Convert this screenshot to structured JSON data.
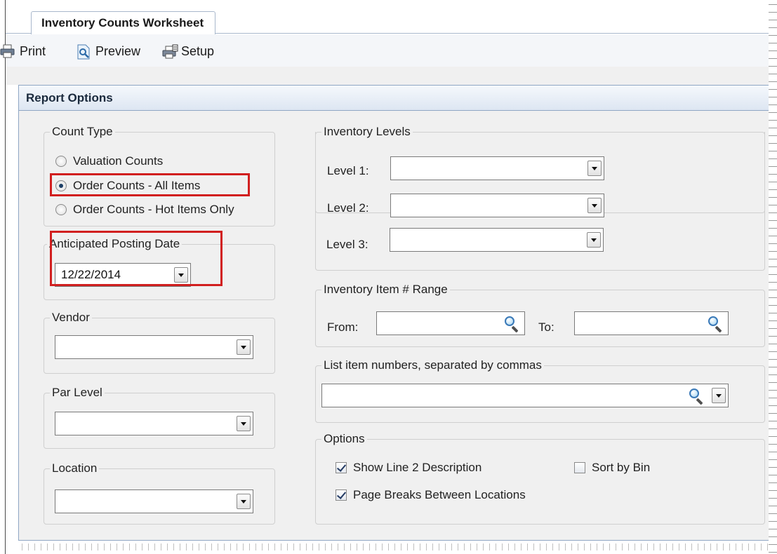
{
  "window": {
    "tab_label": "Inventory Counts Worksheet"
  },
  "toolbar": {
    "buttons": [
      {
        "label": "Print",
        "icon": "printer-icon"
      },
      {
        "label": "Preview",
        "icon": "preview-icon"
      },
      {
        "label": "Setup",
        "icon": "setup-icon"
      }
    ]
  },
  "panel": {
    "title": "Report Options"
  },
  "count_type": {
    "title": "Count Type",
    "options": [
      {
        "label": "Valuation Counts",
        "selected": false
      },
      {
        "label": "Order Counts - All Items",
        "selected": true
      },
      {
        "label": "Order Counts - Hot Items Only",
        "selected": false
      }
    ]
  },
  "posting_date": {
    "title": "Anticipated Posting Date",
    "value": "12/22/2014"
  },
  "vendor": {
    "title": "Vendor",
    "value": ""
  },
  "par_level": {
    "title": "Par Level",
    "value": ""
  },
  "location": {
    "title": "Location",
    "value": ""
  },
  "inventory_levels": {
    "title": "Inventory Levels",
    "levels": [
      {
        "label": "Level 1:",
        "value": ""
      },
      {
        "label": "Level 2:",
        "value": ""
      },
      {
        "label": "Level 3:",
        "value": ""
      }
    ]
  },
  "item_range": {
    "title": "Inventory Item # Range",
    "from_label": "From:",
    "to_label": "To:",
    "from_value": "",
    "to_value": ""
  },
  "item_list": {
    "title": "List item numbers, separated by commas",
    "value": ""
  },
  "options": {
    "title": "Options",
    "checkboxes": [
      {
        "label": "Show Line 2 Description",
        "checked": true
      },
      {
        "label": "Sort by Bin",
        "checked": false
      },
      {
        "label": "Page Breaks Between Locations",
        "checked": true
      }
    ]
  },
  "colors": {
    "highlight": "#d11f1f",
    "header_border": "#8fa6c4",
    "panel_bg": "#f0f0f0"
  }
}
